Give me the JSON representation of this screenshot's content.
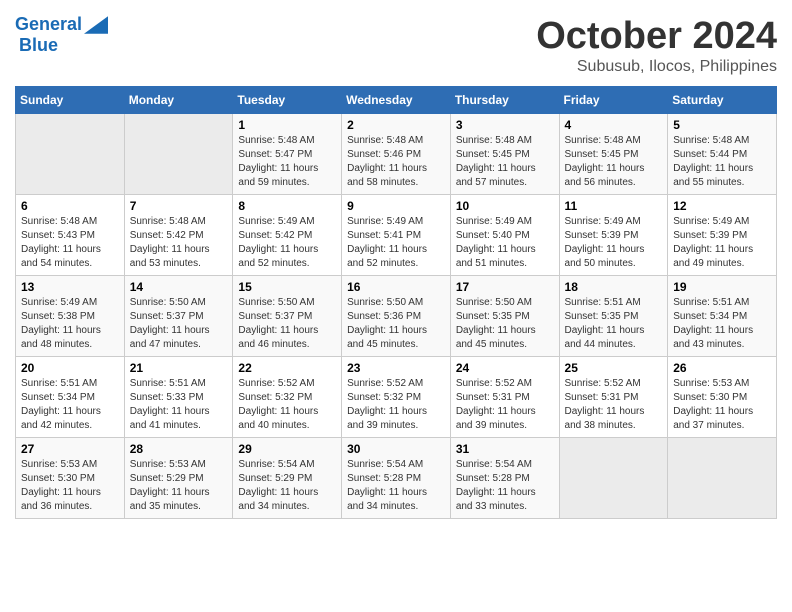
{
  "header": {
    "logo_line1": "General",
    "logo_line2": "Blue",
    "month": "October 2024",
    "location": "Subusub, Ilocos, Philippines"
  },
  "columns": [
    "Sunday",
    "Monday",
    "Tuesday",
    "Wednesday",
    "Thursday",
    "Friday",
    "Saturday"
  ],
  "weeks": [
    [
      {
        "day": "",
        "info": ""
      },
      {
        "day": "",
        "info": ""
      },
      {
        "day": "1",
        "sunrise": "5:48 AM",
        "sunset": "5:47 PM",
        "daylight": "11 hours and 59 minutes."
      },
      {
        "day": "2",
        "sunrise": "5:48 AM",
        "sunset": "5:46 PM",
        "daylight": "11 hours and 58 minutes."
      },
      {
        "day": "3",
        "sunrise": "5:48 AM",
        "sunset": "5:45 PM",
        "daylight": "11 hours and 57 minutes."
      },
      {
        "day": "4",
        "sunrise": "5:48 AM",
        "sunset": "5:45 PM",
        "daylight": "11 hours and 56 minutes."
      },
      {
        "day": "5",
        "sunrise": "5:48 AM",
        "sunset": "5:44 PM",
        "daylight": "11 hours and 55 minutes."
      }
    ],
    [
      {
        "day": "6",
        "sunrise": "5:48 AM",
        "sunset": "5:43 PM",
        "daylight": "11 hours and 54 minutes."
      },
      {
        "day": "7",
        "sunrise": "5:48 AM",
        "sunset": "5:42 PM",
        "daylight": "11 hours and 53 minutes."
      },
      {
        "day": "8",
        "sunrise": "5:49 AM",
        "sunset": "5:42 PM",
        "daylight": "11 hours and 52 minutes."
      },
      {
        "day": "9",
        "sunrise": "5:49 AM",
        "sunset": "5:41 PM",
        "daylight": "11 hours and 52 minutes."
      },
      {
        "day": "10",
        "sunrise": "5:49 AM",
        "sunset": "5:40 PM",
        "daylight": "11 hours and 51 minutes."
      },
      {
        "day": "11",
        "sunrise": "5:49 AM",
        "sunset": "5:39 PM",
        "daylight": "11 hours and 50 minutes."
      },
      {
        "day": "12",
        "sunrise": "5:49 AM",
        "sunset": "5:39 PM",
        "daylight": "11 hours and 49 minutes."
      }
    ],
    [
      {
        "day": "13",
        "sunrise": "5:49 AM",
        "sunset": "5:38 PM",
        "daylight": "11 hours and 48 minutes."
      },
      {
        "day": "14",
        "sunrise": "5:50 AM",
        "sunset": "5:37 PM",
        "daylight": "11 hours and 47 minutes."
      },
      {
        "day": "15",
        "sunrise": "5:50 AM",
        "sunset": "5:37 PM",
        "daylight": "11 hours and 46 minutes."
      },
      {
        "day": "16",
        "sunrise": "5:50 AM",
        "sunset": "5:36 PM",
        "daylight": "11 hours and 45 minutes."
      },
      {
        "day": "17",
        "sunrise": "5:50 AM",
        "sunset": "5:35 PM",
        "daylight": "11 hours and 45 minutes."
      },
      {
        "day": "18",
        "sunrise": "5:51 AM",
        "sunset": "5:35 PM",
        "daylight": "11 hours and 44 minutes."
      },
      {
        "day": "19",
        "sunrise": "5:51 AM",
        "sunset": "5:34 PM",
        "daylight": "11 hours and 43 minutes."
      }
    ],
    [
      {
        "day": "20",
        "sunrise": "5:51 AM",
        "sunset": "5:34 PM",
        "daylight": "11 hours and 42 minutes."
      },
      {
        "day": "21",
        "sunrise": "5:51 AM",
        "sunset": "5:33 PM",
        "daylight": "11 hours and 41 minutes."
      },
      {
        "day": "22",
        "sunrise": "5:52 AM",
        "sunset": "5:32 PM",
        "daylight": "11 hours and 40 minutes."
      },
      {
        "day": "23",
        "sunrise": "5:52 AM",
        "sunset": "5:32 PM",
        "daylight": "11 hours and 39 minutes."
      },
      {
        "day": "24",
        "sunrise": "5:52 AM",
        "sunset": "5:31 PM",
        "daylight": "11 hours and 39 minutes."
      },
      {
        "day": "25",
        "sunrise": "5:52 AM",
        "sunset": "5:31 PM",
        "daylight": "11 hours and 38 minutes."
      },
      {
        "day": "26",
        "sunrise": "5:53 AM",
        "sunset": "5:30 PM",
        "daylight": "11 hours and 37 minutes."
      }
    ],
    [
      {
        "day": "27",
        "sunrise": "5:53 AM",
        "sunset": "5:30 PM",
        "daylight": "11 hours and 36 minutes."
      },
      {
        "day": "28",
        "sunrise": "5:53 AM",
        "sunset": "5:29 PM",
        "daylight": "11 hours and 35 minutes."
      },
      {
        "day": "29",
        "sunrise": "5:54 AM",
        "sunset": "5:29 PM",
        "daylight": "11 hours and 34 minutes."
      },
      {
        "day": "30",
        "sunrise": "5:54 AM",
        "sunset": "5:28 PM",
        "daylight": "11 hours and 34 minutes."
      },
      {
        "day": "31",
        "sunrise": "5:54 AM",
        "sunset": "5:28 PM",
        "daylight": "11 hours and 33 minutes."
      },
      {
        "day": "",
        "info": ""
      },
      {
        "day": "",
        "info": ""
      }
    ]
  ],
  "labels": {
    "sunrise": "Sunrise:",
    "sunset": "Sunset:",
    "daylight": "Daylight:"
  }
}
